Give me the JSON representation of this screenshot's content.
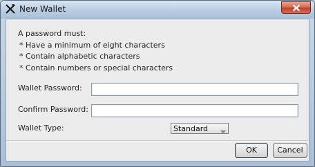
{
  "window": {
    "title": "New Wallet",
    "app_icon": "x-logo-icon",
    "close_icon": "close-icon"
  },
  "requirements": {
    "heading": "A password must:",
    "items": [
      "* Have a minimum of eight characters",
      "* Contain alphabetic characters",
      "* Contain numbers or special characters"
    ]
  },
  "form": {
    "wallet_password_label": "Wallet Password:",
    "wallet_password_value": "",
    "confirm_password_label": "Confirm Password:",
    "confirm_password_value": "",
    "wallet_type_label": "Wallet Type:",
    "wallet_type_value": "Standard",
    "dropdown_icon": "chevron-down-icon"
  },
  "buttons": {
    "ok": "OK",
    "cancel": "Cancel"
  }
}
